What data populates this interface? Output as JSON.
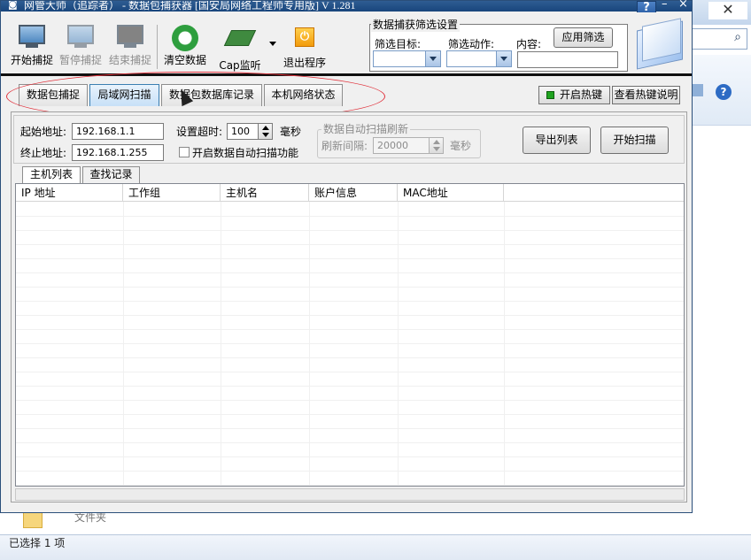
{
  "background": {
    "close_glyph": "✕",
    "search_icon": "search-icon",
    "help_glyph": "?",
    "folder_label": "文件夹",
    "status_text": "已选择 1 项"
  },
  "window": {
    "title": "网管大师（追踪者） - 数据包捕获器 [国安局网络工程师专用版] V 1.281",
    "help_glyph": "?",
    "minimize_glyph": "–",
    "close_glyph": "×"
  },
  "toolbar": {
    "start_capture": "开始捕捉",
    "pause_capture": "暂停捕捉",
    "stop_capture": "结束捕捉",
    "clear_data": "清空数据",
    "cap_monitor": "Cap监听",
    "exit_program": "退出程序"
  },
  "filter": {
    "group_title": "数据捕获筛选设置",
    "target_label": "筛选目标:",
    "action_label": "筛选动作:",
    "content_label": "内容:",
    "target_value": "",
    "action_value": "",
    "content_value": "",
    "apply_button": "应用筛选"
  },
  "tabs": [
    {
      "label": "数据包捕捉",
      "active": false
    },
    {
      "label": "局域网扫描",
      "active": true
    },
    {
      "label": "数据包数据库记录",
      "active": false
    },
    {
      "label": "本机网络状态",
      "active": false
    }
  ],
  "hotkeys": {
    "enable_hotkey": "开启热键",
    "view_hotkey_help": "查看热键说明"
  },
  "scan": {
    "start_addr_label": "起始地址:",
    "start_addr": "192.168.1.1",
    "end_addr_label": "终止地址:",
    "end_addr": "192.168.1.255",
    "timeout_label": "设置超时:",
    "timeout_value": "100",
    "timeout_unit": "毫秒",
    "auto_scan_checkbox": "开启数据自动扫描功能",
    "auto_group_title": "数据自动扫描刷新",
    "refresh_label": "刷新间隔:",
    "refresh_value": "20000",
    "refresh_unit": "毫秒",
    "export_button": "导出列表",
    "start_scan_button": "开始扫描"
  },
  "subtabs": [
    {
      "label": "主机列表",
      "active": true
    },
    {
      "label": "查找记录",
      "active": false
    }
  ],
  "table": {
    "columns": [
      "IP 地址",
      "工作组",
      "主机名",
      "账户信息",
      "MAC地址"
    ],
    "rows": []
  }
}
